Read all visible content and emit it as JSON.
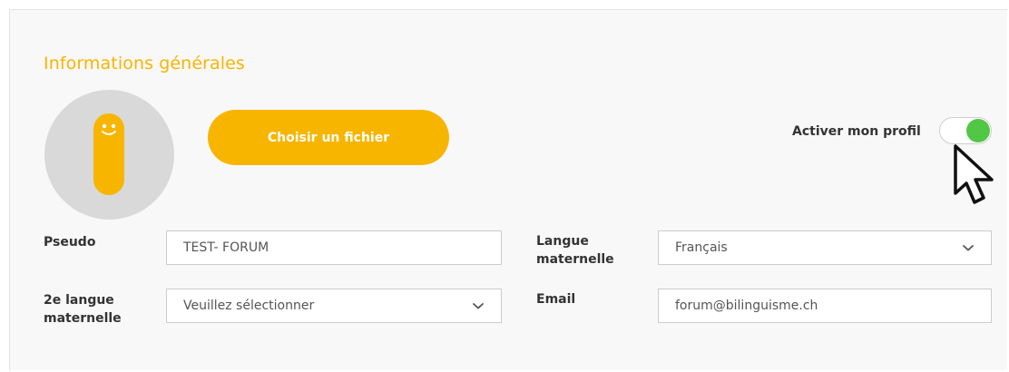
{
  "section": {
    "title": "Informations générales"
  },
  "avatar": {
    "icon": "smiling-pill-avatar-icon",
    "color": "#f7b500"
  },
  "upload": {
    "button_label": "Choisir un fichier"
  },
  "profile_toggle": {
    "label": "Activer mon profil",
    "enabled": true,
    "on_color": "#52c745"
  },
  "form": {
    "pseudo": {
      "label": "Pseudo",
      "value": "TEST- FORUM"
    },
    "native_language": {
      "label_line1": "Langue",
      "label_line2": "maternelle",
      "selected": "Français"
    },
    "second_native_language": {
      "label_line1": "2e langue",
      "label_line2": "maternelle",
      "selected": "Veuillez sélectionner"
    },
    "email": {
      "label": "Email",
      "value": "forum@bilinguisme.ch"
    }
  },
  "colors": {
    "accent": "#f7b500",
    "panel_background": "#f8f8f8"
  }
}
